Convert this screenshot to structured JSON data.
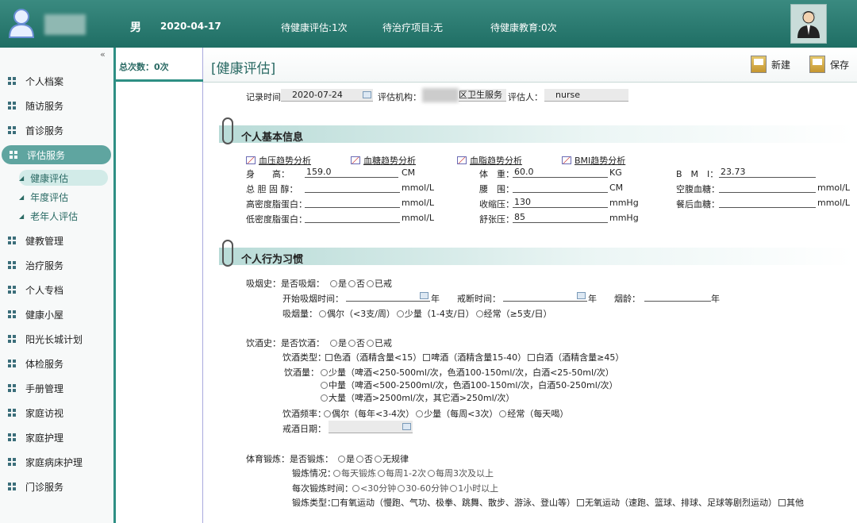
{
  "topbar": {
    "gender": "男",
    "date": "2020-04-17",
    "pending_eval": "待健康评估:1次",
    "pending_treat": "待治疗项目:无",
    "pending_edu": "待健康教育:0次"
  },
  "sidebar": {
    "items": [
      {
        "label": "个人档案"
      },
      {
        "label": "随访服务"
      },
      {
        "label": "首诊服务"
      },
      {
        "label": "评估服务"
      },
      {
        "label": "健教管理"
      },
      {
        "label": "治疗服务"
      },
      {
        "label": "个人专档"
      },
      {
        "label": "健康小屋"
      },
      {
        "label": "阳光长城计划"
      },
      {
        "label": "体检服务"
      },
      {
        "label": "手册管理"
      },
      {
        "label": "家庭访视"
      },
      {
        "label": "家庭护理"
      },
      {
        "label": "家庭病床护理"
      },
      {
        "label": "门诊服务"
      }
    ],
    "subitems": [
      {
        "label": "健康评估"
      },
      {
        "label": "年度评估"
      },
      {
        "label": "老年人评估"
      }
    ]
  },
  "midcol": {
    "totals": "总次数：0次"
  },
  "header": {
    "title": "[健康评估]",
    "new_label": "新建",
    "save_label": "保存"
  },
  "form": {
    "record_time_label": "记录时间：",
    "record_time": "2020-07-24",
    "org_label": "评估机构：",
    "org_value": "区卫生服务",
    "assessor_label": "评估人：",
    "assessor": "nurse",
    "sec1_title": "个人基本信息",
    "trends": [
      "血压趋势分析",
      "血糖趋势分析",
      "血脂趋势分析",
      "BMI趋势分析"
    ],
    "height_label": "身　　高：",
    "height": "159.0",
    "height_unit": "CM",
    "weight_label": "体　重：",
    "weight": "60.0",
    "weight_unit": "KG",
    "bmi_label": "B　M　I：",
    "bmi": "23.73",
    "chol_label": "总 胆 固 醇：",
    "waist_label": "腰　围：",
    "fasting_label": "空腹血糖：",
    "hdl_label": "高密度脂蛋白：",
    "sbp_label": "收缩压：",
    "sbp": "130",
    "postmeal_label": "餐后血糖：",
    "ldl_label": "低密度脂蛋白：",
    "dbp_label": "舒张压：",
    "dbp": "85",
    "u_mmol": "mmol/L",
    "u_cm": "CM",
    "u_mmhg": "mmHg",
    "sec2_title": "个人行为习惯",
    "smoke_hist": "吸烟史：是否吸烟：",
    "smoke_opts": [
      "是",
      "否",
      "已戒"
    ],
    "smoke_start": "开始吸烟时间：",
    "year": "年",
    "smoke_quit": "戒断时间：",
    "smoke_age": "烟龄：",
    "smoke_amt": "吸烟量：",
    "smoke_amt_opts": [
      "偶尔（<3支/周）",
      "少量（1-4支/日）",
      "经常（≥5支/日）"
    ],
    "drink_hist": "饮酒史：是否饮酒：",
    "drink_opts": [
      "是",
      "否",
      "已戒"
    ],
    "drink_type": "饮酒类型：",
    "drink_type_opts": [
      "色酒（酒精含量<15）",
      "啤酒（酒精含量15-40）",
      "白酒（酒精含量≥45）"
    ],
    "drink_amt": "饮酒量：",
    "drink_amt_opts": [
      "少量（啤酒<250-500ml/次，色酒100-150ml/次，白酒<25-50ml/次）",
      "中量（啤酒<500-2500ml/次，色酒100-150ml/次，白酒50-250ml/次）",
      "大量（啤酒>2500ml/次，其它酒>250ml/次）"
    ],
    "drink_freq": "饮酒频率：",
    "drink_freq_opts": [
      "偶尔（每年<3-4次）",
      "少量（每周<3次）",
      "经常（每天喝）"
    ],
    "drink_quit": "戒酒日期：",
    "ex_hist": "体育锻炼：是否锻炼：",
    "ex_opts": [
      "是",
      "否",
      "无规律"
    ],
    "ex_situation": "锻炼情况：",
    "ex_situation_opts": [
      "每天锻炼",
      "每周1-2次",
      "每周3次及以上"
    ],
    "ex_time": "每次锻炼时间：",
    "ex_time_opts": [
      "<30分钟",
      "30-60分钟",
      "1小时以上"
    ],
    "ex_type": "锻炼类型：",
    "ex_type_opts": [
      "有氧运动（慢跑、气功、极拳、跳舞、散步、游泳、登山等）",
      "无氧运动（速跑、篮球、排球、足球等剧烈运动）",
      "其他"
    ]
  }
}
